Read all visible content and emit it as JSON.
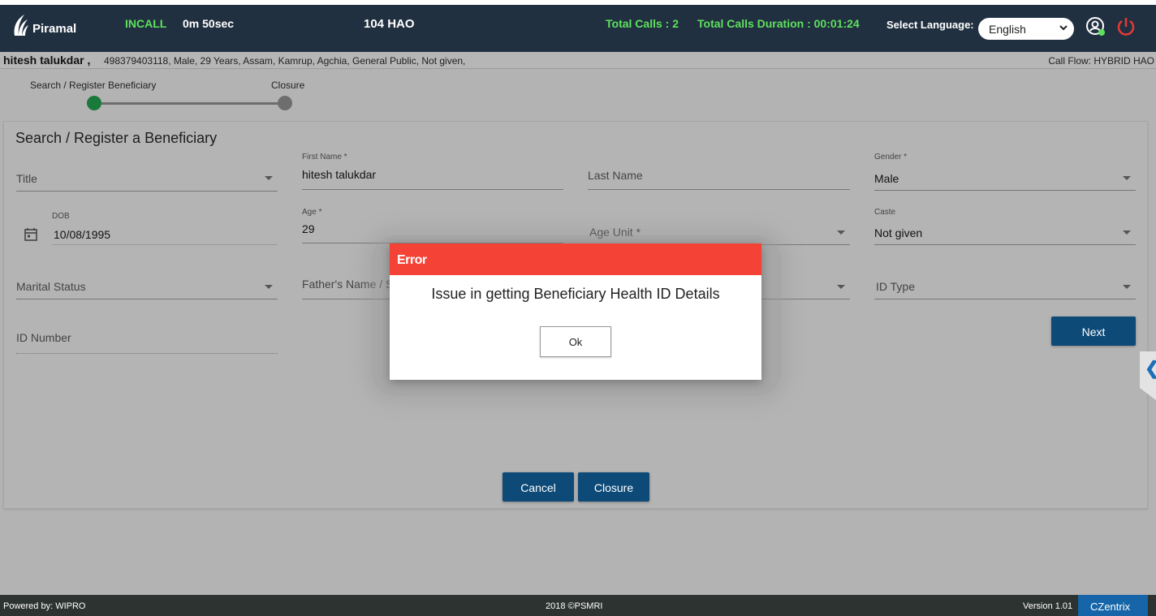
{
  "header": {
    "logo_text": "Piramal",
    "call_status": "INCALL",
    "call_timer": "0m 50sec",
    "center_title": "104 HAO",
    "total_calls": "Total Calls : 2",
    "total_duration": "Total Calls Duration : 00:01:24",
    "language_label": "Select Language:",
    "language_value": "English"
  },
  "beneficiary_bar": {
    "name": "hitesh talukdar ,",
    "details": "498379403118,   Male,   29 Years,   Assam,   Kamrup,   Agchia,   General Public,   Not given,",
    "call_flow": "Call Flow: HYBRID HAO"
  },
  "stepper": {
    "steps": [
      "Search / Register Beneficiary",
      "Closure"
    ],
    "colors": {
      "active": "#1a7a3c",
      "inactive": "#6e6e6e"
    }
  },
  "form": {
    "title": "Search / Register a Beneficiary",
    "title_field": {
      "placeholder": "Title"
    },
    "first_name": {
      "label": "First Name *",
      "value": "hitesh talukdar"
    },
    "last_name": {
      "placeholder": "Last Name"
    },
    "gender": {
      "label": "Gender *",
      "value": "Male"
    },
    "dob": {
      "label": "DOB",
      "value": "10/08/1995"
    },
    "age": {
      "label": "Age *",
      "value": "29"
    },
    "age_unit": {
      "placeholder": "Age Unit *"
    },
    "caste": {
      "label": "Caste",
      "value": "Not given"
    },
    "marital_status": {
      "placeholder": "Marital Status"
    },
    "fathers_name": {
      "placeholder": "Father's Name / S"
    },
    "id_type": {
      "placeholder": "ID Type"
    },
    "id_number": {
      "placeholder": "ID Number"
    },
    "next_label": "Next",
    "cancel_label": "Cancel",
    "closure_label": "Closure"
  },
  "dialog": {
    "title": "Error",
    "message": "Issue in getting Beneficiary Health ID Details",
    "ok_label": "Ok",
    "header_color": "#f44336"
  },
  "footer": {
    "powered_by": "Powered by: WIPRO",
    "copyright": "2018 ©PSMRI",
    "version": "Version 1.01",
    "brand": "CZentrix"
  },
  "colors": {
    "header_bg": "#213040",
    "accent_green": "#5ee05e",
    "primary_button": "#0d4a78",
    "footer_bg": "#2d3330"
  }
}
